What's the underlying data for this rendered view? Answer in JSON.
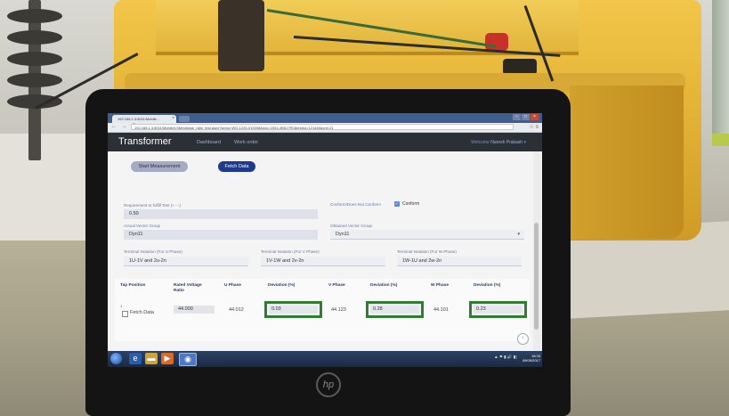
{
  "browser": {
    "tab_title": "192.168.1.3:8011/Mobile...",
    "tab_close": "×",
    "url": "192.168.1.3:8011/Mobile/LSM/voltage_ratio_test.aspx?wono=WO-1226-015008&sno=1904-3B617R0&testno=121446&cnt=21",
    "nav_icons": "← → C",
    "addr_icons": "☆ ≡",
    "window_buttons": [
      "–",
      "□",
      "×"
    ]
  },
  "app": {
    "brand": "Transformer",
    "nav_links": [
      "Dashboard",
      "Work order"
    ],
    "user_prefix": "Welcome",
    "user_name": "Naresh Prakash"
  },
  "buttons": {
    "start": "Start Measurement",
    "fetch": "Fetch Data"
  },
  "form": {
    "requirement_label": "Requirement to fulfill Test (+ - -)",
    "requirement_value": "0.50",
    "conform_label": "Conform/Does Not Conform",
    "conform_value": "Conform",
    "actual_vector_label": "Actual Vector Group",
    "actual_vector_value": "Dyn11",
    "obtained_vector_label": "Obtained Vector Group",
    "obtained_vector_value": "Dyn11",
    "terminal_u_label": "Terminal Notation (For U Phase)",
    "terminal_u_value": "1U-1V and 2u-2n",
    "terminal_v_label": "Terminal Notation (For V Phase)",
    "terminal_v_value": "1V-1W and 2v-2n",
    "terminal_w_label": "Terminal Notation (For W Phase)",
    "terminal_w_value": "1W-1U and 2w-2n"
  },
  "table": {
    "headers": [
      "Tap Position",
      "Rated Voltage Ratio",
      "U Phase",
      "Deviation (%)",
      "V Phase",
      "Deviation (%)",
      "W Phase",
      "Deviation (%)"
    ],
    "row": {
      "tap": "1",
      "fetch_label": "Fetch Data",
      "rated": "44.000",
      "u_phase": "44.012",
      "u_dev": "0.03",
      "v_phase": "44.123",
      "v_dev": "0.28",
      "w_phase": "44.101",
      "w_dev": "0.23"
    }
  },
  "taskbar": {
    "tray": "▲ ⚑ ▮ 🔊 ◧",
    "time": "18:33",
    "date": "06/05/2017"
  },
  "device": {
    "logo": "hp"
  },
  "colors": {
    "nav_bg": "#2b2f36",
    "primary_button": "#1f3a8a",
    "deviation_border": "#2f7d32",
    "case_yellow": "#e5b538"
  }
}
